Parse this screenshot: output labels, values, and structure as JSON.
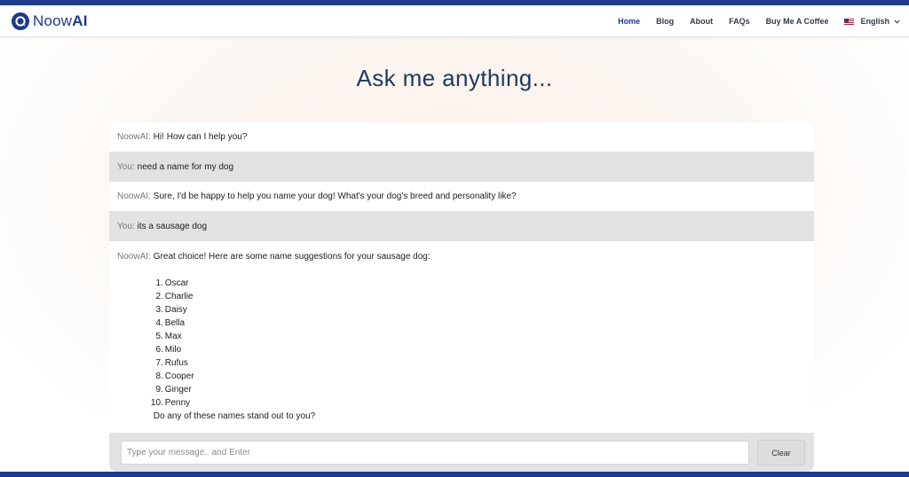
{
  "brand": {
    "prefix": "Noow",
    "suffix": "AI"
  },
  "nav": {
    "home": "Home",
    "blog": "Blog",
    "about": "About",
    "faqs": "FAQs",
    "coffee": "Buy Me A Coffee",
    "language": "English"
  },
  "page": {
    "title": "Ask me anything..."
  },
  "chat": {
    "messages": [
      {
        "sender": "NoowAI:",
        "role": "bot",
        "text": "Hi! How can I help you?"
      },
      {
        "sender": "You:",
        "role": "user",
        "text": "need a name for my dog"
      },
      {
        "sender": "NoowAI:",
        "role": "bot",
        "text": "Sure, I'd be happy to help you name your dog! What's your dog's breed and personality like?"
      },
      {
        "sender": "You:",
        "role": "user",
        "text": "its a sausage dog"
      },
      {
        "sender": "NoowAI:",
        "role": "bot",
        "text": "Great choice! Here are some name suggestions for your sausage dog:",
        "list": [
          {
            "num": "1.",
            "name": "Oscar"
          },
          {
            "num": "2.",
            "name": "Charlie"
          },
          {
            "num": "3.",
            "name": "Daisy"
          },
          {
            "num": "4.",
            "name": "Bella"
          },
          {
            "num": "5.",
            "name": "Max"
          },
          {
            "num": "6.",
            "name": "Milo"
          },
          {
            "num": "7.",
            "name": "Rufus"
          },
          {
            "num": "8.",
            "name": "Cooper"
          },
          {
            "num": "9.",
            "name": "Ginger"
          },
          {
            "num": "10.",
            "name": "Penny"
          }
        ],
        "outro": "Do any of these names stand out to you?"
      }
    ]
  },
  "input": {
    "placeholder": "Type your message.. and Enter",
    "value": ""
  },
  "clear_label": "Clear",
  "colors": {
    "brand": "#1e3a8a",
    "title": "#1e3a62",
    "user_row": "#e2e2e2"
  },
  "icons": {
    "logo": "chat-bubble-logo-icon",
    "flag": "us-flag-icon",
    "chevron": "chevron-down-icon"
  }
}
